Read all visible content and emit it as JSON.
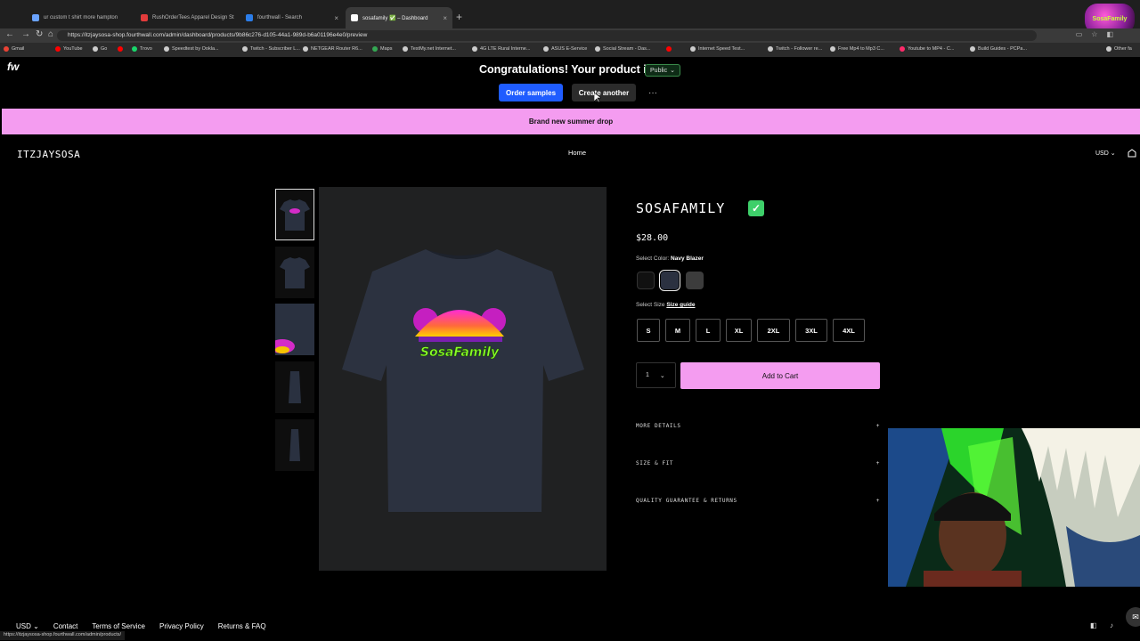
{
  "browser": {
    "tabs": [
      {
        "label": "ur custom t shirt more hampton",
        "fav_color": "#6aa3ff"
      },
      {
        "label": "RushOrderTees Apparel Design St",
        "fav_color": "#e23b3b"
      },
      {
        "label": "fourthwall - Search",
        "fav_color": "#2b7de9"
      },
      {
        "label": "sosafamily ✅ – Dashboard",
        "fav_color": "#ffffff"
      }
    ],
    "new_tab": "+",
    "url": "https://itzjaysosa-shop.fourthwall.com/admin/dashboard/products/9b86c276-d105-44a1-989d-b6a01196e4e0/preview",
    "profile_badge": "SosaFamily",
    "bookmarks": [
      {
        "label": "Gmail",
        "color": "#ea4335"
      },
      {
        "label": "YouTube",
        "color": "#ff0000"
      },
      {
        "label": "Go",
        "color": "#cccccc"
      },
      {
        "label": "",
        "color": "#ff0000"
      },
      {
        "label": "Trovo",
        "color": "#19d66b"
      },
      {
        "label": "Speedtest by Ookla...",
        "color": "#cccccc"
      },
      {
        "label": "Twitch - Subscriber L...",
        "color": "#cccccc"
      },
      {
        "label": "NETGEAR Router R6...",
        "color": "#cccccc"
      },
      {
        "label": "Maps",
        "color": "#34a853"
      },
      {
        "label": "TestMy.net Internet...",
        "color": "#cccccc"
      },
      {
        "label": "4G LTE Rural Interne...",
        "color": "#cccccc"
      },
      {
        "label": "ASUS E-Service",
        "color": "#cccccc"
      },
      {
        "label": "Social Stream - Das...",
        "color": "#cccccc"
      },
      {
        "label": "",
        "color": "#ff0000"
      },
      {
        "label": "Internet Speed Test...",
        "color": "#cccccc"
      },
      {
        "label": "Twitch - Follower re...",
        "color": "#cccccc"
      },
      {
        "label": "Free Mp4 to Mp3 C...",
        "color": "#cccccc"
      },
      {
        "label": "Youtube to MP4 - C...",
        "color": "#ff2a6a"
      },
      {
        "label": "Build Guides - PCPa...",
        "color": "#cccccc"
      },
      {
        "label": "Other fa",
        "color": "#cccccc"
      }
    ]
  },
  "admin": {
    "logo": "fw",
    "congrats": "Congratulations! Your product is",
    "visibility": "Public",
    "order_samples": "Order samples",
    "create_another": "Create another",
    "more": "···"
  },
  "promo": "Brand new summer drop",
  "store": {
    "name": "ITZJAYSOSA",
    "home": "Home",
    "currency": "USD"
  },
  "product": {
    "title": "SOSAFAMILY",
    "check": "✓",
    "price": "$28.00",
    "color_label": "Select Color:",
    "color_value": "Navy Blazer",
    "colors": [
      {
        "name": "Black",
        "hex": "#111111"
      },
      {
        "name": "Navy Blazer",
        "hex": "#2b3140"
      },
      {
        "name": "Charcoal",
        "hex": "#3c3c3c"
      }
    ],
    "size_label": "Select Size",
    "size_guide": "Size guide",
    "sizes": [
      "S",
      "M",
      "L",
      "XL",
      "2XL",
      "3XL",
      "4XL"
    ],
    "quantity": "1",
    "add_to_cart": "Add to Cart",
    "shirt_text": "SosaFamily",
    "accordions": [
      {
        "label": "MORE DETAILS",
        "icon": "+"
      },
      {
        "label": "SIZE & FIT",
        "icon": "+"
      },
      {
        "label": "QUALITY GUARANTEE & RETURNS",
        "icon": "+"
      }
    ]
  },
  "footer": {
    "currency": "USD",
    "links": [
      "Contact",
      "Terms of Service",
      "Privacy Policy",
      "Returns & FAQ"
    ],
    "status_url": "https://itzjaysosa-shop.fourthwall.com/admin/products/"
  }
}
